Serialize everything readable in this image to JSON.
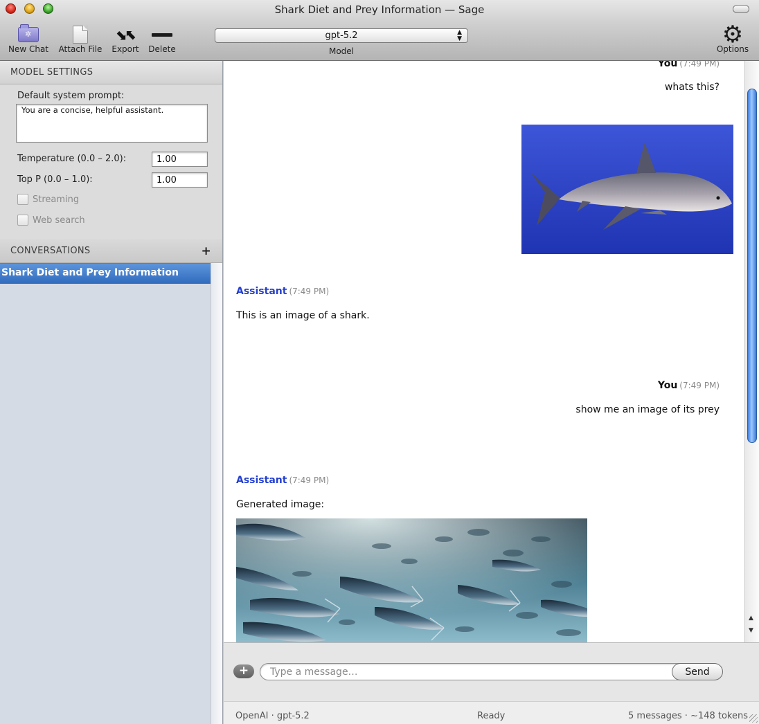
{
  "window": {
    "title": "Shark Diet and Prey Information — Sage"
  },
  "toolbar": {
    "new_chat": "New Chat",
    "attach_file": "Attach File",
    "export": "Export",
    "delete": "Delete",
    "model_value": "gpt-5.2",
    "model_caption": "Model",
    "options": "Options"
  },
  "model_settings": {
    "header": "MODEL SETTINGS",
    "system_prompt_label": "Default system prompt:",
    "system_prompt_value": "You are a concise, helpful assistant.",
    "temperature_label": "Temperature (0.0 – 2.0):",
    "temperature_value": "1.00",
    "top_p_label": "Top P (0.0 – 1.0):",
    "top_p_value": "1.00",
    "streaming_label": "Streaming",
    "streaming_checked": false,
    "web_search_label": "Web search",
    "web_search_checked": false
  },
  "conversations": {
    "header": "CONVERSATIONS",
    "add_label": "+",
    "items": [
      {
        "label": "Shark Diet and Prey Information",
        "selected": true
      }
    ]
  },
  "messages": [
    {
      "role": "user",
      "who": "You",
      "time": "(7:49 PM)",
      "text": "whats this?",
      "image": "shark-photo"
    },
    {
      "role": "assistant",
      "who": "Assistant",
      "time": "(7:49 PM)",
      "text": "This is an image of a shark."
    },
    {
      "role": "user",
      "who": "You",
      "time": "(7:49 PM)",
      "text": "show me an image of its prey"
    },
    {
      "role": "assistant",
      "who": "Assistant",
      "time": "(7:49 PM)",
      "text": "Generated image:",
      "image": "fish-school-image"
    }
  ],
  "composer": {
    "placeholder": "Type a message…",
    "send_label": "Send",
    "attach_label": "+"
  },
  "status": {
    "left": "OpenAI · gpt-5.2",
    "center": "Ready",
    "right": "5 messages · ~148 tokens"
  },
  "colors": {
    "accent_blue": "#2f6bbd",
    "assistant_name": "#2440d0",
    "scroll_thumb": "#3f7fe0"
  }
}
